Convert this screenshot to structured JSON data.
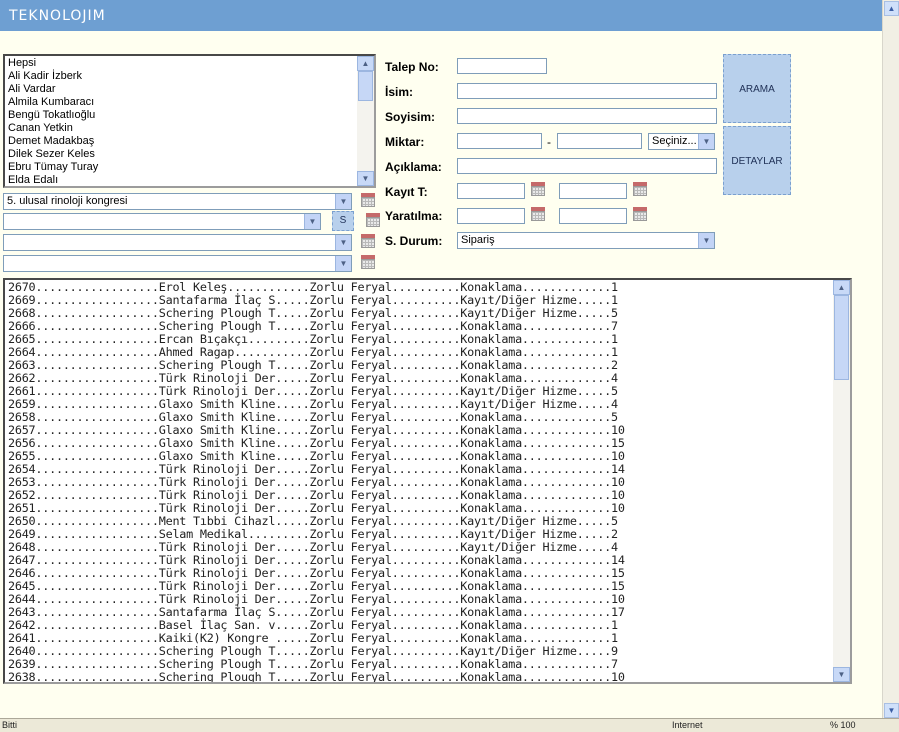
{
  "header": {
    "logo_text": "TEKNOLOJIM"
  },
  "people_list": {
    "items": [
      "Hepsi",
      "Ali Kadir İzberk",
      "Ali Vardar",
      "Almila Kumbaracı",
      "Bengü Tokatlıoğlu",
      "Canan Yetkin",
      "Demet Madakbaş",
      "Dilek Sezer Keles",
      "Ebru Tümay Turay",
      "Elda Edalı"
    ]
  },
  "filters": {
    "event_select": "5. ulusal rinoloji kongresi",
    "select2": "",
    "select3": "",
    "select4": "",
    "s_button": "S"
  },
  "form": {
    "talep_no_label": "Talep No:",
    "isim_label": "İsim:",
    "soyisim_label": "Soyisim:",
    "miktar_label": "Miktar:",
    "miktar_dash": "-",
    "miktar_select": "Seçiniz...",
    "aciklama_label": "Açıklama:",
    "kayit_label": "Kayıt T:",
    "yaratilma_label": "Yaratılma:",
    "durum_label": "S. Durum:",
    "durum_value": "Sipariş",
    "arama_button": "ARAMA",
    "detaylar_button": "DETAYLAR"
  },
  "results": {
    "rows": [
      "2670..................Erol Keleş............Zorlu Feryal..........Konaklama.............1",
      "2669..................Santafarma İlaç S.....Zorlu Feryal..........Kayıt/Diğer Hizme.....1",
      "2668..................Schering Plough T.....Zorlu Feryal..........Kayıt/Diğer Hizme.....5",
      "2666..................Schering Plough T.....Zorlu Feryal..........Konaklama.............7",
      "2665..................Ercan Bıçakçı.........Zorlu Feryal..........Konaklama.............1",
      "2664..................Ahmed Ragap...........Zorlu Feryal..........Konaklama.............1",
      "2663..................Schering Plough T.....Zorlu Feryal..........Konaklama.............2",
      "2662..................Türk Rinoloji Der.....Zorlu Feryal..........Konaklama.............4",
      "2661..................Türk Rinoloji Der.....Zorlu Feryal..........Kayıt/Diğer Hizme.....5",
      "2659..................Glaxo Smith Kline.....Zorlu Feryal..........Kayıt/Diğer Hizme.....4",
      "2658..................Glaxo Smith Kline.....Zorlu Feryal..........Konaklama.............5",
      "2657..................Glaxo Smith Kline.....Zorlu Feryal..........Konaklama.............10",
      "2656..................Glaxo Smith Kline.....Zorlu Feryal..........Konaklama.............15",
      "2655..................Glaxo Smith Kline.....Zorlu Feryal..........Konaklama.............10",
      "2654..................Türk Rinoloji Der.....Zorlu Feryal..........Konaklama.............14",
      "2653..................Türk Rinoloji Der.....Zorlu Feryal..........Konaklama.............10",
      "2652..................Türk Rinoloji Der.....Zorlu Feryal..........Konaklama.............10",
      "2651..................Türk Rinoloji Der.....Zorlu Feryal..........Konaklama.............10",
      "2650..................Ment Tıbbi Cihazl.....Zorlu Feryal..........Kayıt/Diğer Hizme.....5",
      "2649..................Selam Medikal.........Zorlu Feryal..........Kayıt/Diğer Hizme.....2",
      "2648..................Türk Rinoloji Der.....Zorlu Feryal..........Kayıt/Diğer Hizme.....4",
      "2647..................Türk Rinoloji Der.....Zorlu Feryal..........Konaklama.............14",
      "2646..................Türk Rinoloji Der.....Zorlu Feryal..........Konaklama.............15",
      "2645..................Türk Rinoloji Der.....Zorlu Feryal..........Konaklama.............15",
      "2644..................Türk Rinoloji Der.....Zorlu Feryal..........Konaklama.............10",
      "2643..................Santafarma İlaç S.....Zorlu Feryal..........Konaklama.............17",
      "2642..................Basel İlaç San. v.....Zorlu Feryal..........Konaklama.............1",
      "2641..................Kaiki(K2) Kongre .....Zorlu Feryal..........Konaklama.............1",
      "2640..................Schering Plough T.....Zorlu Feryal..........Kayıt/Diğer Hizme.....9",
      "2639..................Schering Plough T.....Zorlu Feryal..........Konaklama.............7",
      "2638..................Schering Plough T.....Zorlu Feryal..........Konaklama.............10"
    ]
  },
  "statusbar": {
    "left": "Bitti",
    "zone": "Internet",
    "zoom": "% 100"
  },
  "colors": {
    "header": "#6e9fd2",
    "page_bg": "#fffff0",
    "button_bg": "#b8d0ec"
  }
}
